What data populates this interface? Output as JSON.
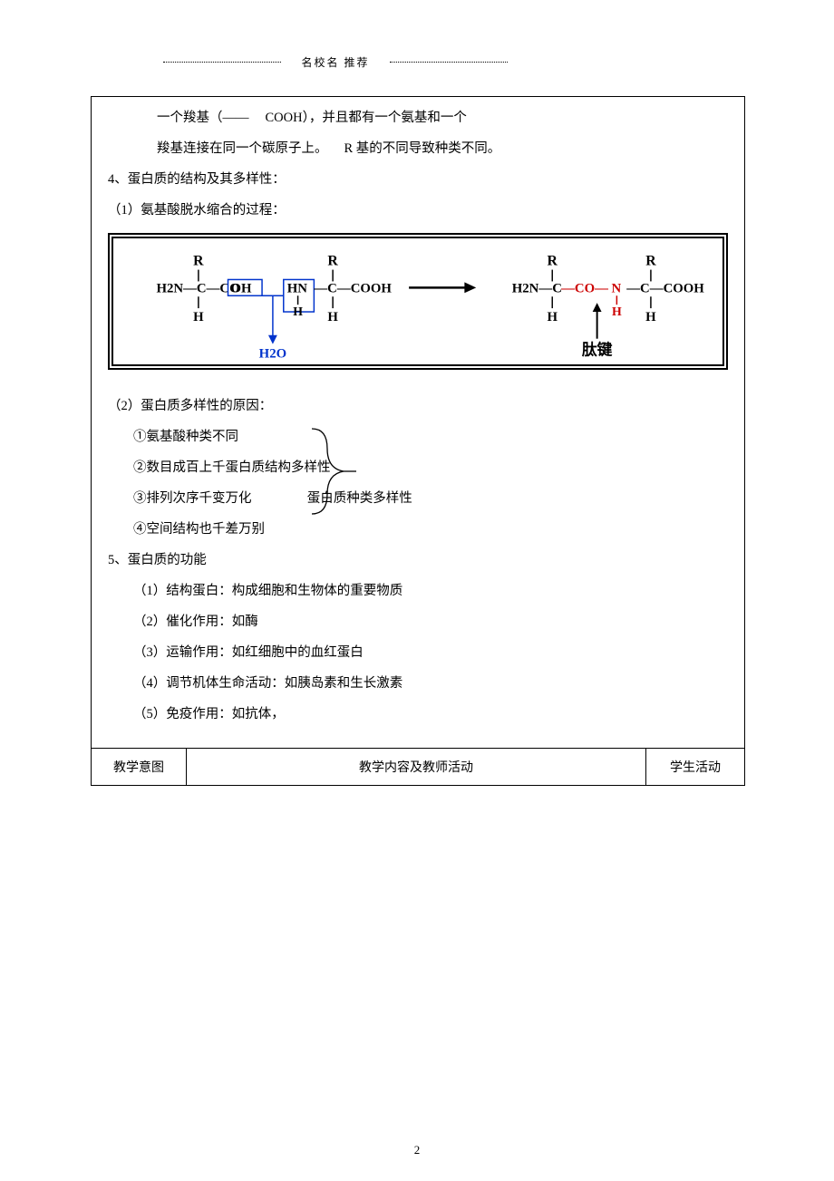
{
  "header": {
    "label": "名校名  推荐"
  },
  "body": {
    "line1_a": "一个羧基（——",
    "line1_b": "COOH），并且都有一个氨基和一个",
    "line2_a": "羧基连接在同一个碳原子上。",
    "line2_b": "R 基的不同导致种类不同。",
    "sec4": "4、蛋白质的结构及其多样性：",
    "sec4_1": "（1）氨基酸脱水缩合的过程：",
    "diagram": {
      "aa_left_top": "R",
      "aa_left_main": "H2N—C—CO",
      "aa_left_oh": "OH",
      "aa_left_bottom": "H",
      "aa_mid_top": "R",
      "aa_mid_hn": "HN",
      "aa_mid_main": "—C—COOH",
      "aa_mid_h": "H",
      "aa_mid_bottom": "H",
      "h2o": "H2O",
      "arrow": "→",
      "prod_left_top": "R",
      "prod_left_main": "H2N—C",
      "prod_co": "—CO—",
      "prod_n": "N",
      "prod_nh_h": "H",
      "prod_right_top": "R",
      "prod_right_main": "—C—COOH",
      "prod_bottom_h": "H",
      "peptide_label": "肽键"
    },
    "sec4_2": "（2）蛋白质多样性的原因：",
    "d1": "①氨基酸种类不同",
    "d2": "②数目成百上千蛋白质结构多样性",
    "d3": "③排列次序千变万化",
    "d3_right": "蛋白质种类多样性",
    "d4": "④空间结构也千差万别",
    "sec5": "5、蛋白质的功能",
    "f1": "（1）结构蛋白：构成细胞和生物体的重要物质",
    "f2": "（2）催化作用：如酶",
    "f3": "（3）运输作用：如红细胞中的血红蛋白",
    "f4": "（4）调节机体生命活动：如胰岛素和生长激素",
    "f5": "（5）免疫作用：如抗体，"
  },
  "footer_row": {
    "c1": "教学意图",
    "c2": "教学内容及教师活动",
    "c3": "学生活动"
  },
  "page_number": "2"
}
